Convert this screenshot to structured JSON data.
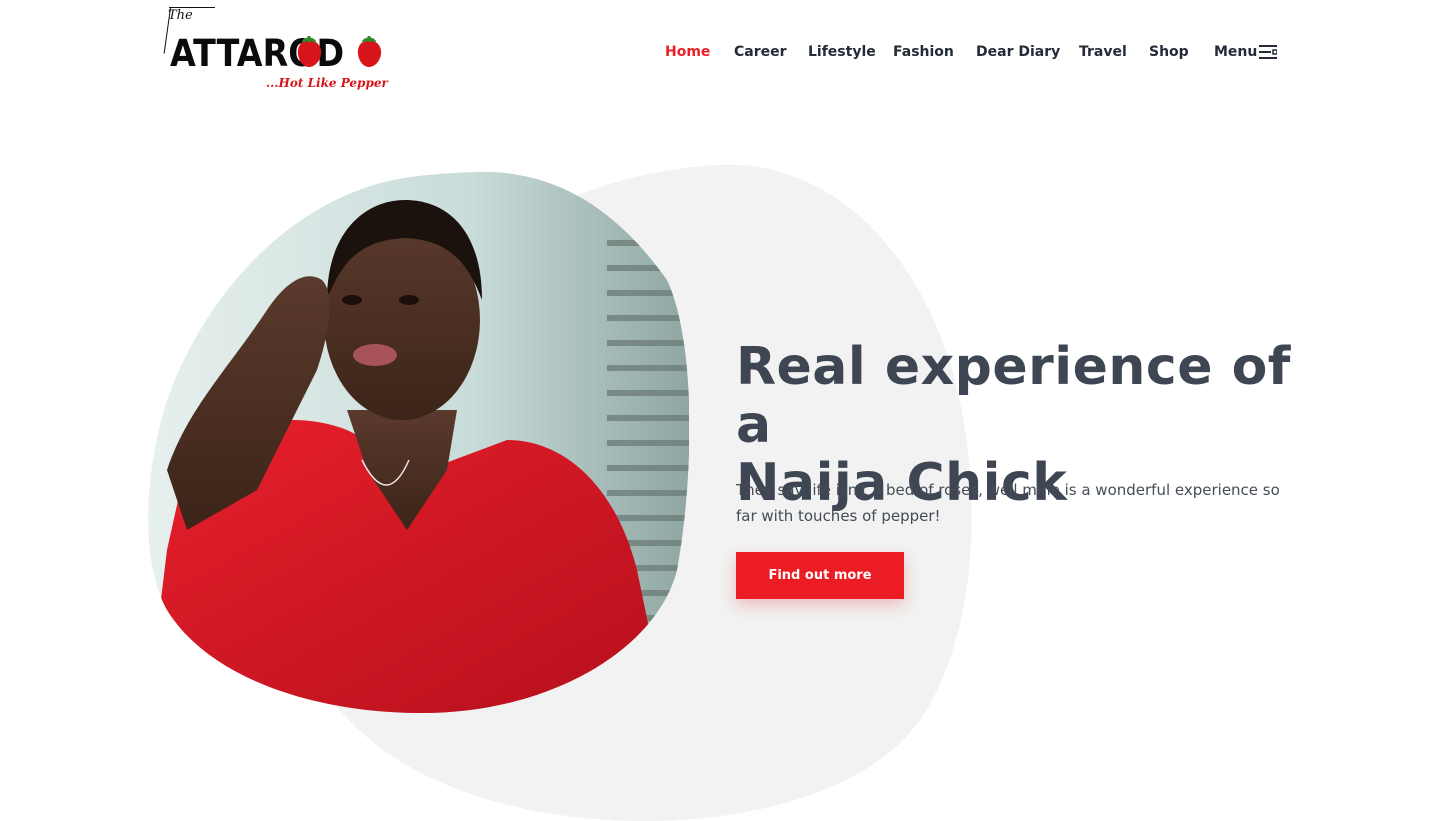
{
  "site": {
    "logo_the": "The",
    "logo_word": "ATTAROD",
    "logo_tagline": "...Hot Like Pepper"
  },
  "nav": {
    "items": [
      {
        "label": "Home",
        "active": true
      },
      {
        "label": "Career",
        "active": false
      },
      {
        "label": "Lifestyle",
        "active": false
      },
      {
        "label": "Fashion",
        "active": false
      },
      {
        "label": "Dear Diary",
        "active": false
      },
      {
        "label": "Travel",
        "active": false
      },
      {
        "label": "Shop",
        "active": false
      }
    ],
    "menu_label": "Menu",
    "menu_icon": "hamburger-menu-icon"
  },
  "hero": {
    "title_line1": "Real experience of a",
    "title_line2": "Naija Chick",
    "subtitle": "They say life isn't a bed of roses, well mine is a wonderful experience so far with touches of pepper!",
    "cta_label": "Find out more"
  },
  "colors": {
    "accent": "#ec1c24",
    "heading": "#3e4653",
    "blob": "#f1f2f1"
  }
}
